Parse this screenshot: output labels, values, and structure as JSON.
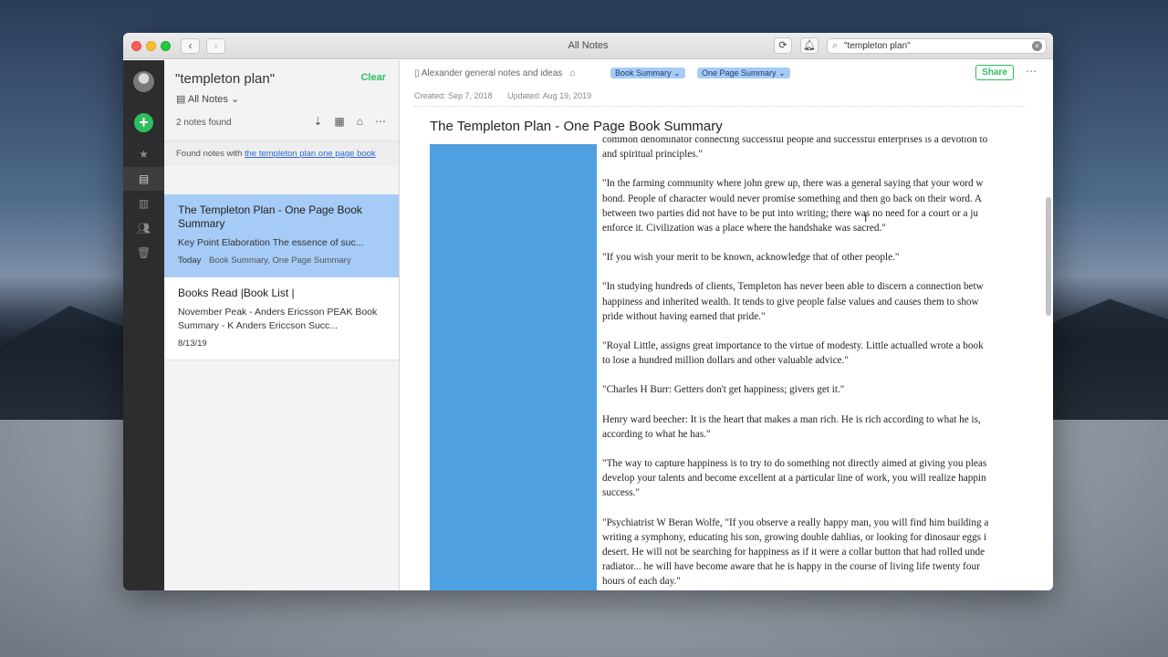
{
  "window": {
    "title": "All Notes",
    "search": {
      "value": "\"templeton plan\""
    }
  },
  "icons": {
    "back": "chevron-left-icon",
    "forward": "chevron-right-icon",
    "sync": "sync-icon",
    "notifications": "bell-icon",
    "search": "search-icon",
    "clear": "clear-icon"
  },
  "note_list": {
    "query_title": "\"templeton plan\"",
    "clear_label": "Clear",
    "scope": "All Notes",
    "count": "2 notes found",
    "found_prefix": "Found notes with",
    "found_link": "the templeton plan  one page book",
    "notes": [
      {
        "title": "The Templeton Plan - One Page Book Summary",
        "snippet": "Key Point Elaboration The essence of suc...",
        "date": "Today",
        "tags": "Book Summary, One Page Summary"
      },
      {
        "title": "Books Read |Book List |",
        "snippet": "November Peak - Anders Ericsson PEAK Book Summary - K Anders Ericcson Succ...",
        "date": "8/13/19",
        "tags": ""
      }
    ]
  },
  "editor": {
    "notebook": "Alexander general notes and ideas",
    "tags": [
      "Book Summary",
      "One Page Summary"
    ],
    "share_label": "Share",
    "created": "Created: Sep 7, 2018",
    "updated": "Updated: Aug 19, 2019",
    "title": "The Templeton Plan - One Page Book Summary",
    "paragraphs": [
      "common denominator connecting successful people and successful enterprises is a devotion to\nand spiritual principles.\"",
      "\"In the farming community where john grew up, there was a general saying that your word w\nbond. People of character would never promise something and then go back on their word. A\nbetween two parties did not have to be put into writing; there was no need for a court or a ju\nenforce it. Civilization was a place where the handshake was sacred.\"",
      "\"If you wish your merit to be known, acknowledge that of other people.\"",
      "\"In studying hundreds of clients, Templeton has never been able to discern a connection betw\nhappiness and inherited wealth. It tends to give people false values and causes them to show\npride without having earned that pride.\"",
      "\"Royal Little, assigns great importance to the virtue of modesty. Little actualled wrote a book\nto lose a hundred million dollars and other valuable advice.\"",
      "\"Charles H Burr: Getters don't get happiness; givers get it.\"",
      "Henry ward beecher: It is the heart that makes a man rich. He is rich according to what he is,\naccording to what he has.\"",
      "\"The way to capture happiness is to try to do something not directly aimed at giving you pleas\ndevelop your talents and become excellent at a particular line of work, you will realize happin\nsuccess.\"",
      "\"Psychiatrist W Beran Wolfe, \"If you observe a really happy man, you will find him building a\nwriting a symphony, educating his son, growing double dahlias, or looking for dinosaur eggs i\ndesert. He will not be searching for happiness as if it were a collar button that had rolled unde\nradiator... he will have become aware that he is happy in the course of living life twenty four\nhours of each day.\""
    ]
  },
  "colors": {
    "accent_green": "#2dbe60",
    "selection_blue": "#a6cbf6",
    "image_placeholder": "#4fa0e0"
  }
}
